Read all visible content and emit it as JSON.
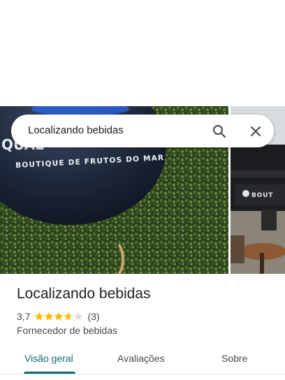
{
  "search": {
    "query": "Localizando bebidas",
    "search_icon": "search-icon",
    "close_icon": "close-icon"
  },
  "hero": {
    "sign_text": "BOUTIQUE DE FRUTOS DO MAR",
    "sign_brand": "QUAL",
    "right_sign_text": "BOUT"
  },
  "place": {
    "title": "Localizando bebidas",
    "rating": "3,7",
    "rating_value": 3.7,
    "rating_max": 5,
    "review_count": "(3)",
    "category": "Fornecedor de bebidas",
    "star_color": "#fbbc04",
    "star_empty_color": "#dadce0"
  },
  "tabs": [
    {
      "label": "Visão geral",
      "active": true
    },
    {
      "label": "Avaliações",
      "active": false
    },
    {
      "label": "Sobre",
      "active": false
    }
  ],
  "colors": {
    "accent": "#0b6d6d",
    "text_primary": "#1f1f1f",
    "text_secondary": "#474747"
  }
}
